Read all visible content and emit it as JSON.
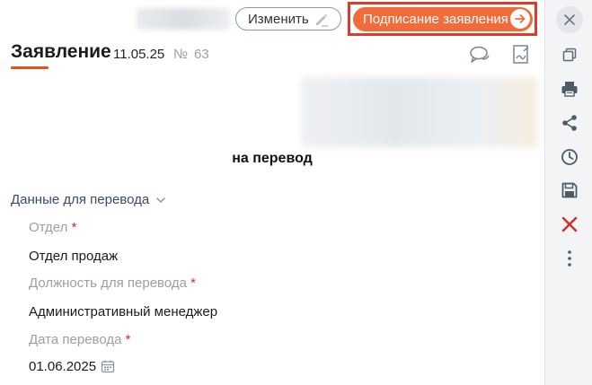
{
  "header": {
    "edit_label": "Изменить",
    "sign_label": "Подписание заявления"
  },
  "document": {
    "title": "Заявление",
    "date": "11.05.25",
    "number_label": "№",
    "number": "63",
    "subject": "на перевод"
  },
  "section": {
    "title": "Данные для перевода",
    "fields": [
      {
        "label": "Отдел",
        "required_mark": "*",
        "value": "Отдел продаж"
      },
      {
        "label": "Должность для перевода",
        "required_mark": "*",
        "value": "Административный менеджер"
      },
      {
        "label": "Дата перевода",
        "required_mark": "*",
        "value": "01.06.2025"
      }
    ]
  },
  "sidebar": {
    "icons": [
      "close-icon",
      "copy-icon",
      "print-icon",
      "share-icon",
      "history-icon",
      "save-icon",
      "delete-icon",
      "more-icon"
    ]
  },
  "colors": {
    "accent": "#f26b3a",
    "highlight_frame": "#e03a2c",
    "required": "#d92b2b",
    "delete": "#d32a2a"
  }
}
